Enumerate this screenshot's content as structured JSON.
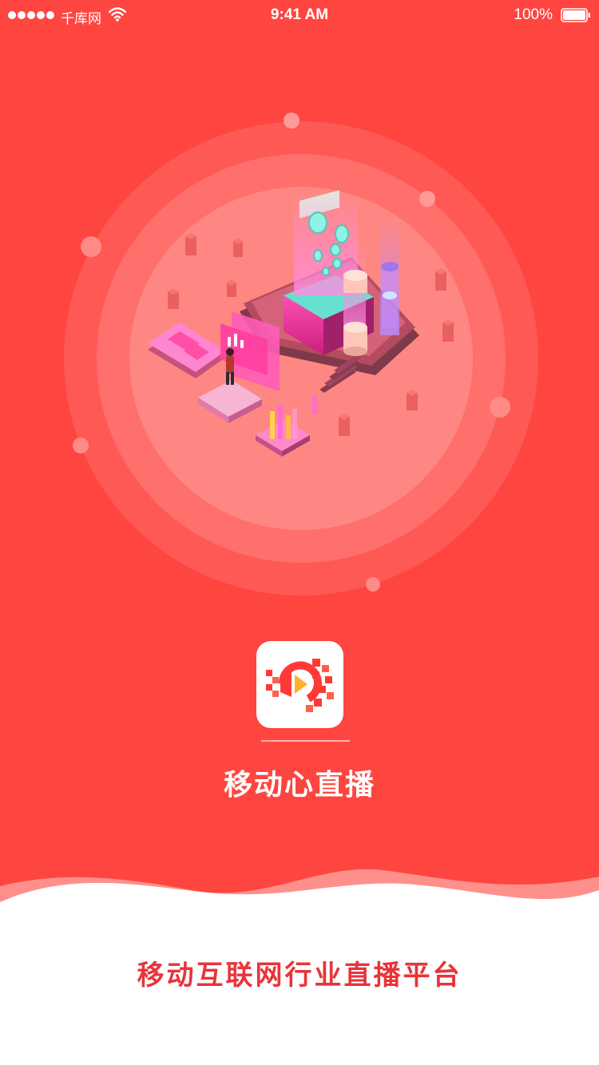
{
  "status_bar": {
    "carrier": "千库网",
    "time": "9:41 AM",
    "battery": "100%"
  },
  "app": {
    "name": "移动心直播",
    "tagline": "移动互联网行业直播平台"
  },
  "icons": {
    "signal": "signal-dots-icon",
    "wifi": "wifi-icon",
    "battery": "battery-icon",
    "logo": "play-logo-icon",
    "illustration": "isometric-live-platform-illustration"
  },
  "colors": {
    "brand_red": "#fe4540",
    "tagline_red": "#e8343a"
  }
}
